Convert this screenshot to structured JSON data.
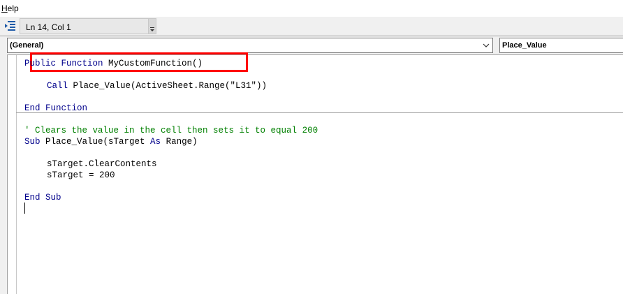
{
  "menu": {
    "help_prefix": "H",
    "help_rest": "elp"
  },
  "toolbar": {
    "status": "Ln 14, Col 1"
  },
  "dropdowns": {
    "object": "(General)",
    "procedure": "Place_Value"
  },
  "code": {
    "line1_kw": "Public Function",
    "line1_name": " MyCustomFunction()",
    "line2_kw": "Call",
    "line2_rest": " Place_Value(ActiveSheet.Range(\"L31\"))",
    "line3": "End Function",
    "line4": "' Clears the value in the cell then sets it to equal 200",
    "line5_kw": "Sub",
    "line5_rest": " Place_Value(sTarget ",
    "line5_as": "As",
    "line5_end": " Range)",
    "line6": "sTarget.ClearContents",
    "line7": "sTarget = 200",
    "line8": "End Sub"
  },
  "colors": {
    "keyword": "#00008b",
    "comment": "#008000",
    "highlight": "#ff0000"
  }
}
